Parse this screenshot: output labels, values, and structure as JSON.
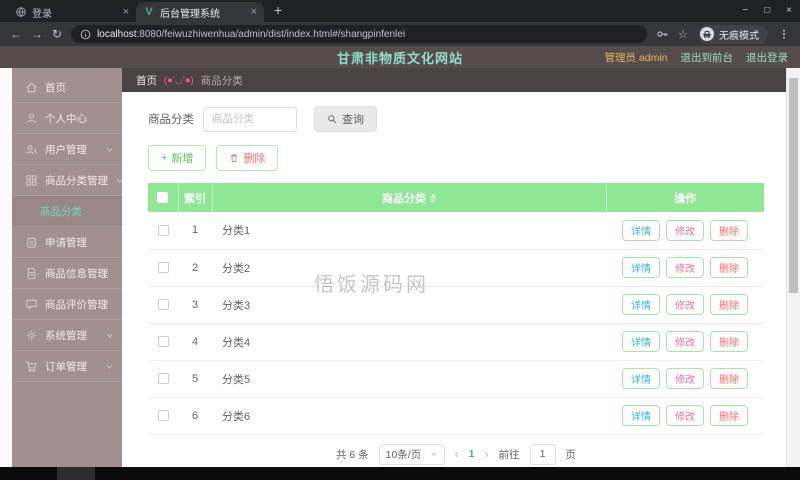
{
  "browser": {
    "tab_login": "登录",
    "tab_admin": "后台管理系统",
    "new_tab_label": "+",
    "tab_close": "×",
    "minimize": "−",
    "maximize": "□",
    "close": "×",
    "back": "←",
    "forward": "→",
    "reload": "↻",
    "url_host": "localhost",
    "url_path": ":8080/feiwuzhiwenhua/admin/dist/index.html#/shangpinfenlei",
    "star": "☆",
    "incognito_label": "无痕模式"
  },
  "header": {
    "title": "甘肃非物质文化网站",
    "admin_label": "管理员 admin",
    "exit_to_front": "退出到前台",
    "logout": "退出登录"
  },
  "breadcrumb": {
    "home": "首页",
    "separator": "(●'◡'●)",
    "current": "商品分类"
  },
  "sidebar": {
    "items": [
      {
        "id": "home",
        "label": "首页",
        "icon": "home",
        "sub": false,
        "active": false,
        "arrow": false
      },
      {
        "id": "profile",
        "label": "个人中心",
        "icon": "user",
        "sub": false,
        "active": false,
        "arrow": false
      },
      {
        "id": "user-mgmt",
        "label": "用户管理",
        "icon": "users",
        "sub": false,
        "active": false,
        "arrow": true
      },
      {
        "id": "category-mgmt",
        "label": "商品分类管理",
        "icon": "grid",
        "sub": false,
        "active": false,
        "arrow": true
      },
      {
        "id": "category",
        "label": "商品分类",
        "icon": null,
        "sub": true,
        "active": true,
        "arrow": false
      },
      {
        "id": "apply-mgmt",
        "label": "申请管理",
        "icon": "clipboard",
        "sub": false,
        "active": false,
        "arrow": false
      },
      {
        "id": "product-info",
        "label": "商品信息管理",
        "icon": "doc",
        "sub": false,
        "active": false,
        "arrow": false
      },
      {
        "id": "product-review",
        "label": "商品评价管理",
        "icon": "chat",
        "sub": false,
        "active": false,
        "arrow": false
      },
      {
        "id": "system-mgmt",
        "label": "系统管理",
        "icon": "gear",
        "sub": false,
        "active": false,
        "arrow": true
      },
      {
        "id": "order-mgmt",
        "label": "订单管理",
        "icon": "cart",
        "sub": false,
        "active": false,
        "arrow": true
      }
    ]
  },
  "toolbar": {
    "search_label": "商品分类",
    "search_placeholder": "商品分类",
    "query_label": "查询",
    "add_label": "新增",
    "delete_label": "删除"
  },
  "table": {
    "headers": {
      "index": "索引",
      "name": "商品分类",
      "ops": "操作"
    },
    "action_labels": [
      "详情",
      "修改",
      "删除"
    ],
    "rows": [
      {
        "index": "1",
        "name": "分类1"
      },
      {
        "index": "2",
        "name": "分类2"
      },
      {
        "index": "3",
        "name": "分类3"
      },
      {
        "index": "4",
        "name": "分类4"
      },
      {
        "index": "5",
        "name": "分类5"
      },
      {
        "index": "6",
        "name": "分类6"
      }
    ]
  },
  "pagination": {
    "total": "共 6 条",
    "page_size": "10条/页",
    "prev": "‹",
    "current_page": "1",
    "next": "›",
    "goto_label": "前往",
    "goto_value": "1",
    "page_unit": "页"
  },
  "watermark": "悟饭源码网",
  "colors": {
    "header_bg": "#564c4c",
    "sidebar_bg": "#a28f8f",
    "table_header_green": "#8fe694",
    "title_mint": "#93dfc9",
    "admin_gold": "#e0b95f",
    "active_menu": "#6fd8c3",
    "detail_teal": "#3cb5c9",
    "edit_pink": "#ee6fa2",
    "danger_red": "#f0716d",
    "breadcrumb_sep_pink": "#e85a9b",
    "page_current_green": "#3aba7f"
  }
}
